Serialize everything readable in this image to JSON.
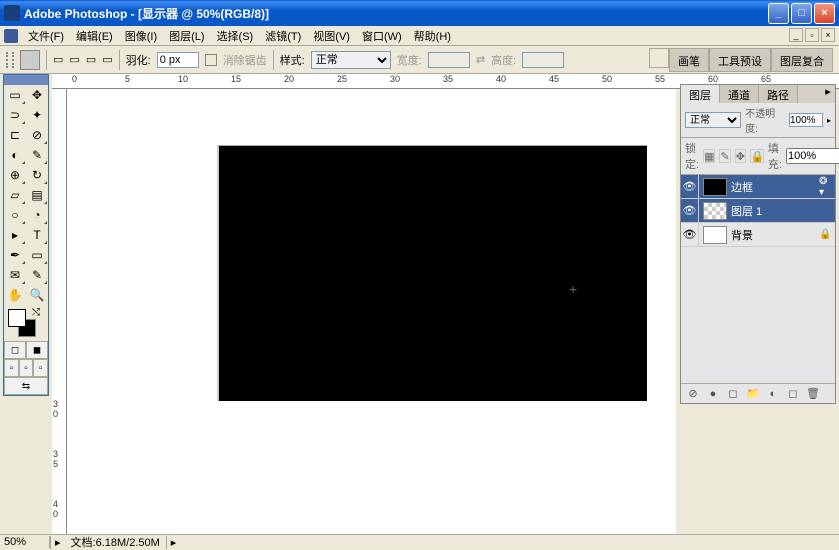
{
  "titlebar": {
    "title": "Adobe Photoshop - [显示器 @ 50%(RGB/8)]"
  },
  "menu": {
    "items": [
      "文件(F)",
      "编辑(E)",
      "图像(I)",
      "图层(L)",
      "选择(S)",
      "滤镜(T)",
      "视图(V)",
      "窗口(W)",
      "帮助(H)"
    ]
  },
  "options": {
    "feather_label": "羽化:",
    "feather_value": "0 px",
    "antialias_label": "消除锯齿",
    "style_label": "样式:",
    "style_value": "正常",
    "width_label": "宽度:",
    "height_label": "高度:",
    "right_tabs": [
      "画笔",
      "工具预设",
      "图层复合"
    ]
  },
  "ruler": {
    "h_labels": [
      "0",
      "5",
      "10",
      "15",
      "20",
      "25",
      "30",
      "35",
      "40",
      "45",
      "50",
      "55",
      "60",
      "65"
    ]
  },
  "layers_panel": {
    "tabs": [
      "图层",
      "通道",
      "路径"
    ],
    "blend_mode": "正常",
    "opacity_label": "不透明度:",
    "opacity_value": "100%",
    "lock_label": "锁定:",
    "fill_label": "填充:",
    "fill_value": "100%",
    "layers": [
      {
        "name": "边框",
        "thumb": "black",
        "selected": true,
        "fx": true
      },
      {
        "name": "图层 1",
        "thumb": "checker",
        "selected": true
      },
      {
        "name": "背景",
        "thumb": "white",
        "locked": true
      }
    ]
  },
  "statusbar": {
    "zoom": "50%",
    "docinfo": "文档:6.18M/2.50M"
  }
}
